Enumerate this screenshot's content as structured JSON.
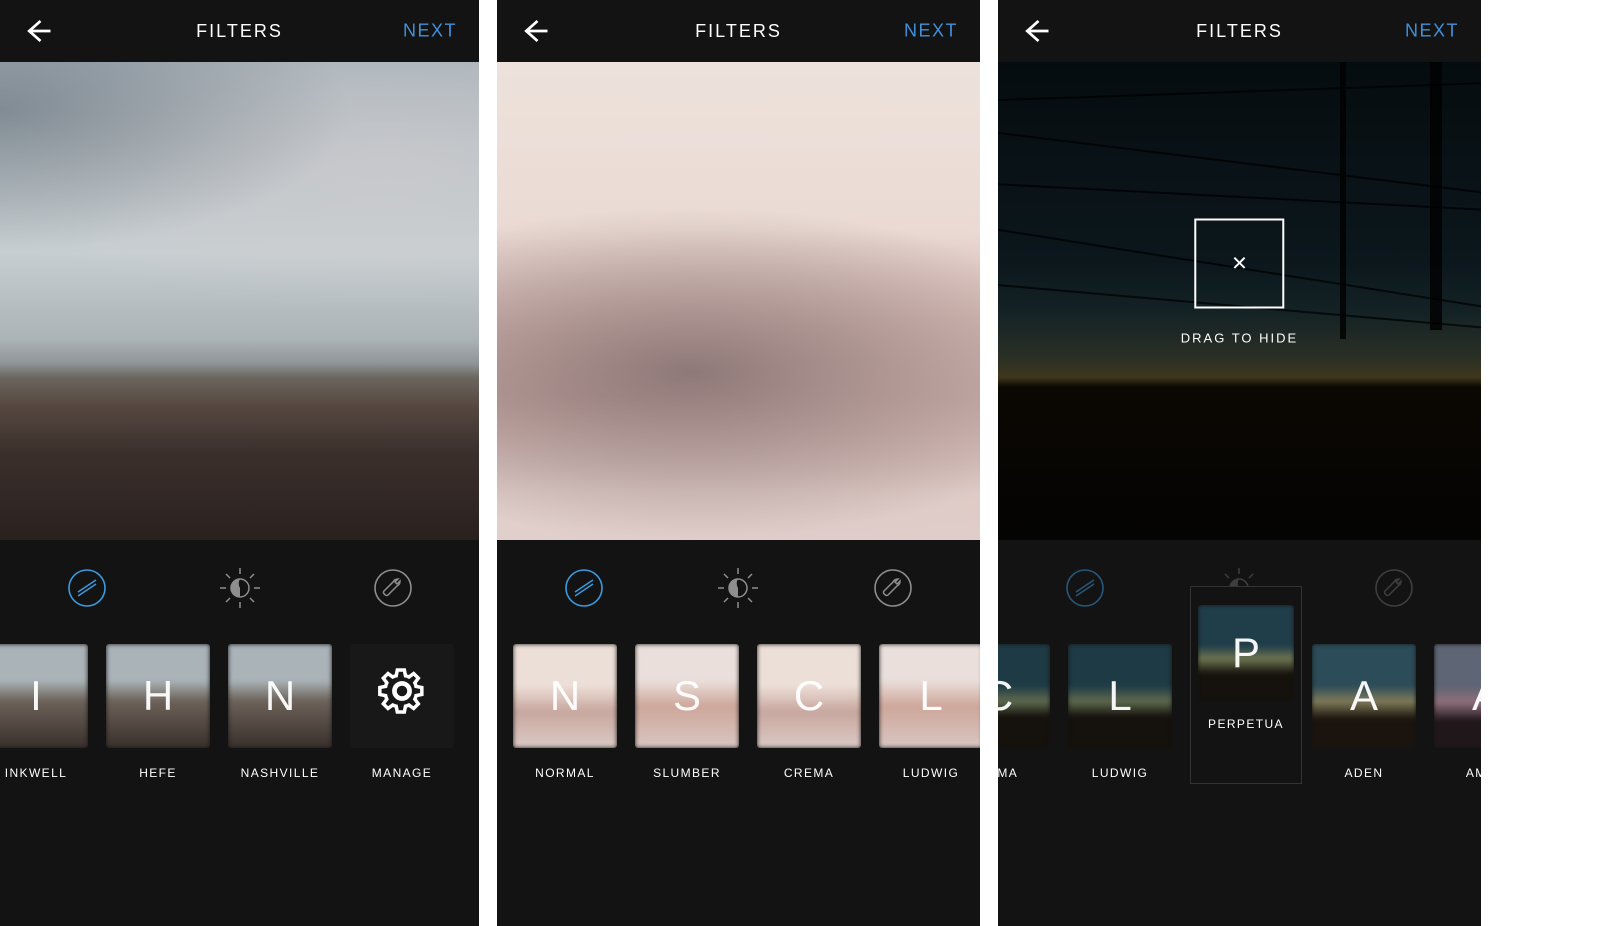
{
  "accent_color": "#4090db",
  "screens": [
    {
      "id": "s1",
      "header_title": "FILTERS",
      "next_label": "NEXT",
      "tools": [
        "filter",
        "lux",
        "wrench"
      ],
      "active_tool": "filter",
      "filters": [
        {
          "letter": "I",
          "name": "INKWELL"
        },
        {
          "letter": "H",
          "name": "HEFE"
        },
        {
          "letter": "N",
          "name": "NASHVILLE"
        },
        {
          "letter": "",
          "name": "MANAGE",
          "manage": true
        }
      ],
      "image": "beach"
    },
    {
      "id": "s2",
      "header_title": "FILTERS",
      "next_label": "NEXT",
      "tools": [
        "filter",
        "lux",
        "wrench"
      ],
      "active_tool": "filter",
      "filters": [
        {
          "letter": "N",
          "name": "NORMAL"
        },
        {
          "letter": "S",
          "name": "SLUMBER"
        },
        {
          "letter": "C",
          "name": "CREMA"
        },
        {
          "letter": "L",
          "name": "LUDWIG"
        }
      ],
      "image": "pink"
    },
    {
      "id": "s3",
      "header_title": "FILTERS",
      "next_label": "NEXT",
      "tools": [
        "filter",
        "lux",
        "wrench"
      ],
      "active_tool": "filter",
      "drag_hint": "DRAG TO HIDE",
      "drag_symbol": "×",
      "floating_filter": {
        "letter": "P",
        "name": "PERPETUA"
      },
      "filters": [
        {
          "letter": "C",
          "name": "REMA"
        },
        {
          "letter": "L",
          "name": "LUDWIG"
        },
        {
          "letter": "A",
          "name": ""
        },
        {
          "letter": "A",
          "name": "ADEN"
        },
        {
          "letter": "A",
          "name": "AMAR"
        }
      ],
      "image": "wires"
    }
  ]
}
